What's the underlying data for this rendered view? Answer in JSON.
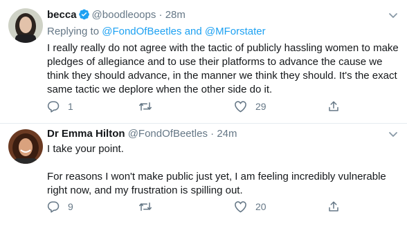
{
  "tweets": [
    {
      "name": "becca",
      "handle": "@boodleoops",
      "time": "28m",
      "replying_prefix": "Replying to",
      "mention1": "@FondOfBeetles",
      "and_word": "and",
      "mention2": "@MForstater",
      "paragraphs": [
        "I really really do not agree with the tactic of publicly hassling women to make pledges of allegiance and to use their platforms to advance the cause we think they should advance, in the manner we think they should. It's the exact same tactic we deplore when the other side do it."
      ],
      "reply_count": "1",
      "retweet_count": "",
      "like_count": "29"
    },
    {
      "name": "Dr Emma Hilton",
      "handle": "@FondOfBeetles",
      "time": "24m",
      "paragraphs": [
        "I take your point.",
        "For reasons I won't make public just yet, I am feeling incredibly vulnerable right now, and my frustration is spilling out."
      ],
      "reply_count": "9",
      "retweet_count": "",
      "like_count": "20"
    }
  ],
  "separator": "·",
  "colors": {
    "link": "#1da1f2",
    "secondary": "#657786",
    "text": "#14171a",
    "divider": "#e6ecf0"
  },
  "icons": [
    "verified-badge-icon",
    "caret-down-icon",
    "reply-icon",
    "retweet-icon",
    "like-icon",
    "share-icon"
  ]
}
